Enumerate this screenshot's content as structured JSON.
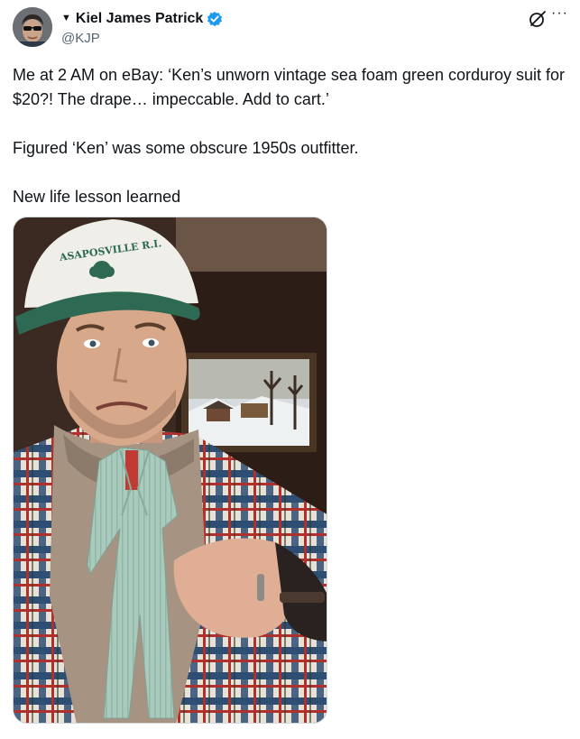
{
  "author": {
    "prefix": "▼",
    "name": "Kiel James Patrick",
    "handle": "@KJP",
    "verified": true,
    "badge_color": "#1d9bf0"
  },
  "actions": {
    "grok_icon": "grok-icon",
    "more_label": "···"
  },
  "tweet": {
    "paragraphs": [
      "Me at 2 AM on eBay: ‘Ken’s unworn vintage sea foam green corduroy suit for $20?! The drape… impeccable. Add to cart.’",
      "Figured ‘Ken’ was some obscure 1950s outfitter.",
      "New life lesson learned"
    ]
  },
  "media": {
    "hat_text": "ASAPOSVILLE R.I."
  }
}
